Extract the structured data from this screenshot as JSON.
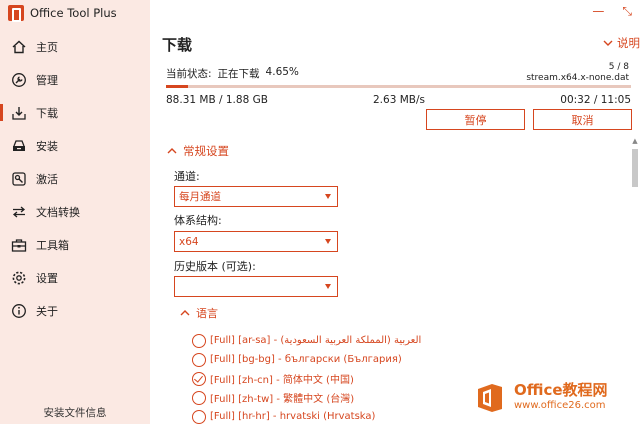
{
  "app": {
    "title": "Office Tool Plus"
  },
  "colors": {
    "accent": "#d6461f",
    "sidebar_bg": "#fbe9e3"
  },
  "window_controls": {
    "minimize": "—",
    "maximize": "⤡"
  },
  "sidebar": {
    "items": [
      {
        "label": "主页",
        "icon": "home-icon"
      },
      {
        "label": "管理",
        "icon": "wrench-icon"
      },
      {
        "label": "下载",
        "icon": "download-icon",
        "active": true
      },
      {
        "label": "安装",
        "icon": "install-icon"
      },
      {
        "label": "激活",
        "icon": "key-icon"
      },
      {
        "label": "文档转换",
        "icon": "convert-icon"
      },
      {
        "label": "工具箱",
        "icon": "toolbox-icon"
      },
      {
        "label": "设置",
        "icon": "gear-icon"
      },
      {
        "label": "关于",
        "icon": "info-icon"
      }
    ],
    "footer": "安装文件信息"
  },
  "main": {
    "title": "下载",
    "help": "说明",
    "status_label": "当前状态:",
    "status_value": "正在下载",
    "percent": "4.65%",
    "progress": 0.0465,
    "counter": "5 / 8",
    "filename": "stream.x64.x-none.dat",
    "downloaded": "88.31 MB / 1.88 GB",
    "speed": "2.63 MB/s",
    "time": "00:32 / 11:05",
    "pause_button": "暂停",
    "cancel_button": "取消"
  },
  "settings": {
    "section_title": "常规设置",
    "channel_label": "通道:",
    "channel_value": "每月通道",
    "arch_label": "体系结构:",
    "arch_value": "x64",
    "history_label": "历史版本 (可选):",
    "history_value": ""
  },
  "languages": {
    "title": "语言",
    "items": [
      {
        "text": "[Full] [ar-sa] - العربية (المملكة العربية السعودية)",
        "checked": false
      },
      {
        "text": "[Full] [bg-bg] - български (България)",
        "checked": false
      },
      {
        "text": "[Full] [zh-cn] - 简体中文 (中国)",
        "checked": true
      },
      {
        "text": "[Full] [zh-tw] - 繁體中文 (台灣)",
        "checked": false
      },
      {
        "text": "[Full] [hr-hr] - hrvatski (Hrvatska)",
        "checked": false
      }
    ]
  },
  "watermark": {
    "title": "Office教程网",
    "url": "www.office26.com"
  }
}
